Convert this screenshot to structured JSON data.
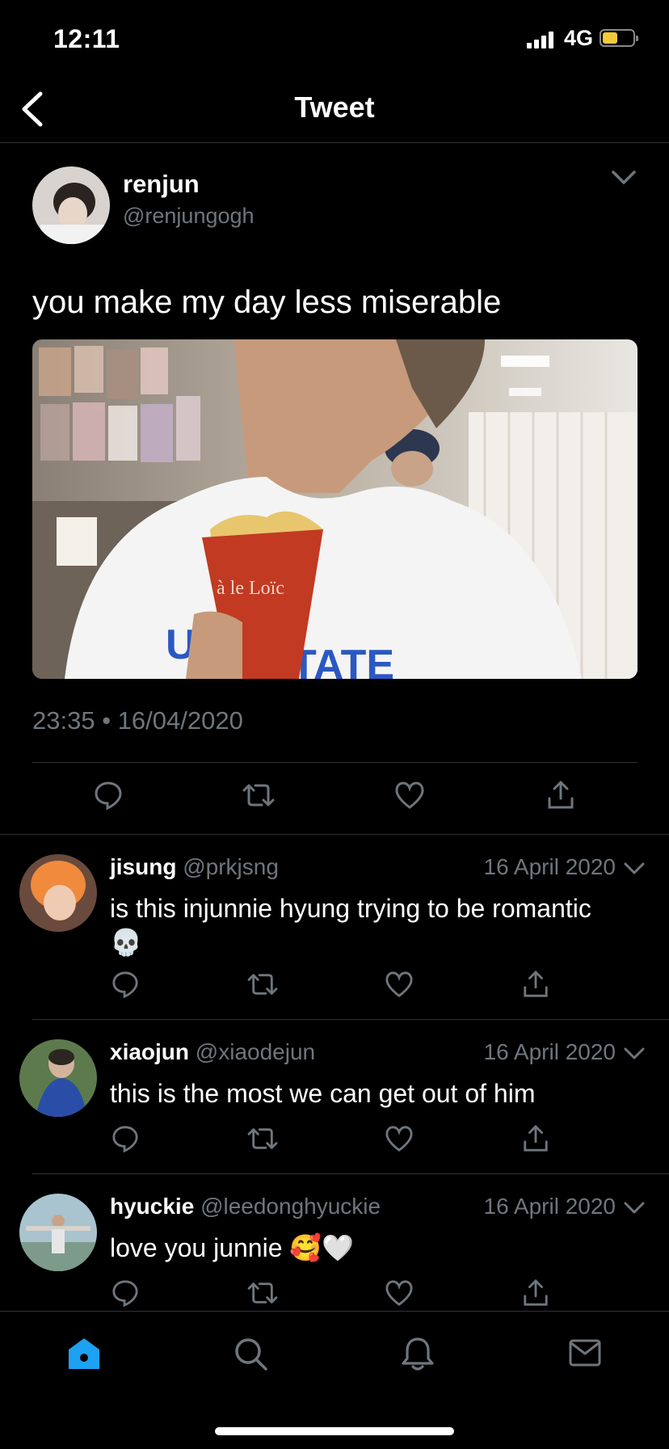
{
  "status_bar": {
    "time": "12:11",
    "network": "4G"
  },
  "nav": {
    "title": "Tweet"
  },
  "tweet": {
    "author_name": "renjun",
    "author_handle": "@renjungogh",
    "text": "you make my day less miserable",
    "timestamp": "23:35 • 16/04/2020",
    "image_text": "à le Loïc"
  },
  "replies": [
    {
      "name": "jisung",
      "handle": "@prkjsng",
      "date": "16 April 2020",
      "text": "is this injunnie hyung trying to be romantic 💀"
    },
    {
      "name": "xiaojun",
      "handle": "@xiaodejun",
      "date": "16 April 2020",
      "text": "this is the most we can get out of him"
    },
    {
      "name": "hyuckie",
      "handle": "@leedonghyuckie",
      "date": "16 April 2020",
      "text": "love you junnie 🥰🤍"
    }
  ],
  "colors": {
    "accent": "#1da1f2",
    "secondary_text": "#6e767d",
    "divider": "#2f3336",
    "battery": "#f3c83b"
  },
  "icons": {
    "action_bar": [
      "reply-icon",
      "retweet-icon",
      "like-icon",
      "share-icon"
    ],
    "tab_bar": [
      "home-icon",
      "search-icon",
      "notifications-icon",
      "messages-icon"
    ]
  }
}
